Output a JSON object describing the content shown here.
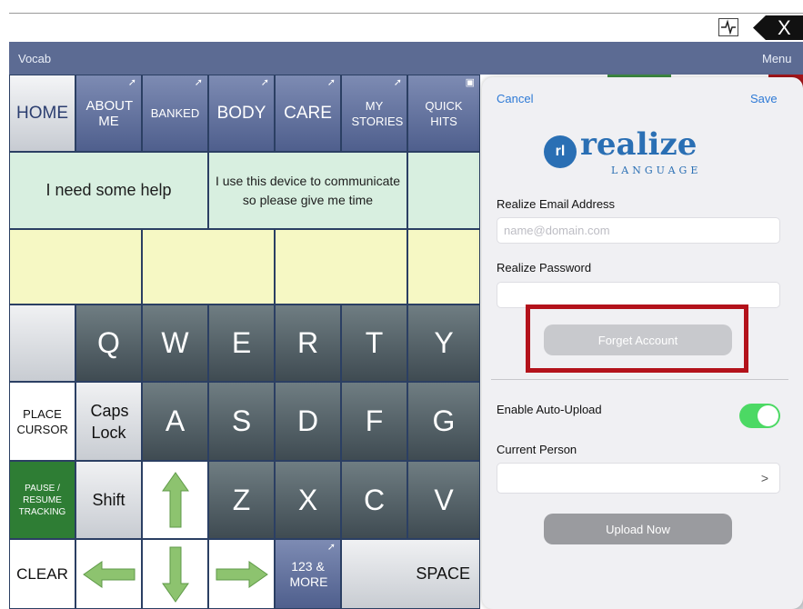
{
  "header": {
    "vocab_label": "Vocab",
    "menu_label": "Menu",
    "close_label": "X"
  },
  "nav_row": [
    {
      "label": "HOME"
    },
    {
      "label": "ABOUT ME"
    },
    {
      "label": "BANKED"
    },
    {
      "label": "BODY"
    },
    {
      "label": "CARE"
    },
    {
      "label": "MY STORIES"
    },
    {
      "label": "QUICK HITS"
    }
  ],
  "phrases": {
    "p1": "I need some help",
    "p2": "I use this device to communicate so please give me time"
  },
  "keys_row1": [
    "Q",
    "W",
    "E",
    "R",
    "T",
    "Y"
  ],
  "keys_row2": [
    "A",
    "S",
    "D",
    "F",
    "G"
  ],
  "keys_row3": [
    "Z",
    "X",
    "C",
    "V"
  ],
  "left_buttons": {
    "place_cursor": "PLACE CURSOR",
    "caps_lock": "Caps Lock",
    "pause": "PAUSE / RESUME TRACKING",
    "shift": "Shift",
    "clear": "CLEAR",
    "more": "123 & MORE",
    "space": "SPACE"
  },
  "modal": {
    "cancel": "Cancel",
    "save": "Save",
    "logo_word": "realize",
    "logo_sub": "LANGUAGE",
    "logo_mark": "rl",
    "email_label": "Realize Email Address",
    "email_placeholder": "name@domain.com",
    "password_label": "Realize Password",
    "forget_button": "Forget Account",
    "auto_upload_label": "Enable Auto-Upload",
    "auto_upload_on": true,
    "current_person_label": "Current Person",
    "upload_button": "Upload Now"
  },
  "colors": {
    "brand_blue": "#2a6fb4",
    "highlight_red": "#b3121b",
    "toggle_green": "#4cd964"
  }
}
